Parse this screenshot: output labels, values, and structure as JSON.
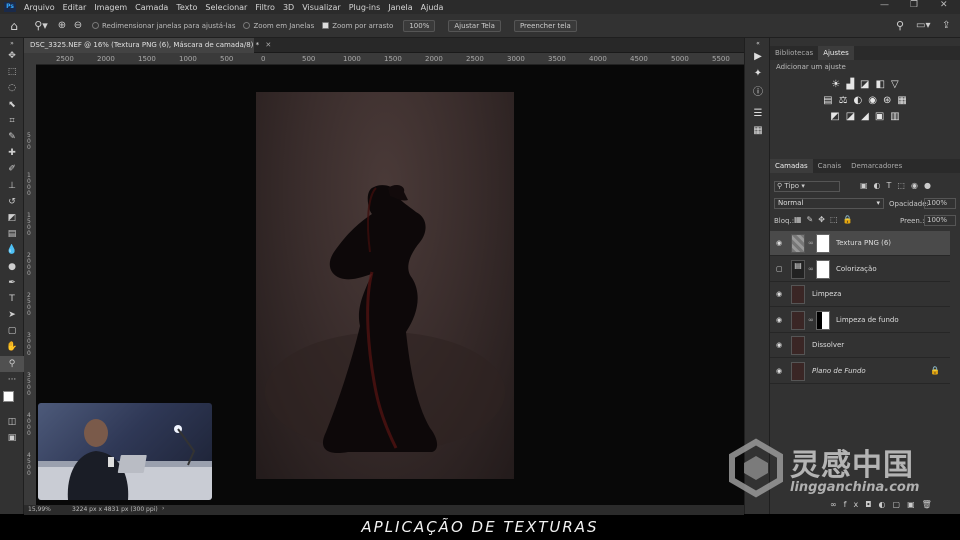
{
  "app": {
    "logo": "Ps"
  },
  "menu": [
    "Arquivo",
    "Editar",
    "Imagem",
    "Camada",
    "Texto",
    "Selecionar",
    "Filtro",
    "3D",
    "Visualizar",
    "Plug-ins",
    "Janela",
    "Ajuda"
  ],
  "options": {
    "resize_windows": "Redimensionar janelas para ajustá-las",
    "zoom_all": "Zoom em Janelas",
    "scrubby_zoom": "Zoom por arrasto",
    "zoom_value": "100%",
    "fit_screen": "Ajustar Tela",
    "fill_screen": "Preencher tela"
  },
  "document": {
    "tab_title": "DSC_3325.NEF @ 16% (Textura PNG (6), Máscara de camada/8) *",
    "zoom": "15,99%",
    "info": "3224 px x 4831 px (300 ppi)"
  },
  "ruler": {
    "h_ticks": [
      "2500",
      "2000",
      "1500",
      "1000",
      "500",
      "0",
      "500",
      "1000",
      "1500",
      "2000",
      "2500",
      "3000",
      "3500",
      "4000",
      "4500",
      "5000",
      "5500"
    ],
    "v_ticks": [
      "5\n0\n0",
      "1\n0\n0\n0",
      "1\n5\n0\n0",
      "2\n0\n0\n0",
      "2\n5\n0\n0",
      "3\n0\n0\n0",
      "3\n5\n0\n0",
      "4\n0\n0\n0",
      "4\n5\n0\n0"
    ]
  },
  "panels": {
    "top_tabs": [
      "Bibliotecas",
      "Ajustes"
    ],
    "adjust_hint": "Adicionar um ajuste",
    "layer_tabs": [
      "Camadas",
      "Canais",
      "Demarcadores"
    ],
    "filter_kind": "Tipo",
    "blend_mode": "Normal",
    "opacity_label": "Opacidade:",
    "opacity_value": "100%",
    "lock_label": "Bloq.:",
    "fill_label": "Preen.:",
    "fill_value": "100%"
  },
  "layers": [
    {
      "name": "Textura PNG (6)",
      "visible": true,
      "selected": true,
      "has_mask": true
    },
    {
      "name": "Colorização",
      "visible": false,
      "selected": false,
      "has_mask": true
    },
    {
      "name": "Limpeza",
      "visible": true,
      "selected": false,
      "has_mask": false
    },
    {
      "name": "Limpeza de fundo",
      "visible": true,
      "selected": false,
      "has_mask": true
    },
    {
      "name": "Dissolver",
      "visible": true,
      "selected": false,
      "has_mask": false
    },
    {
      "name": "Plano de Fundo",
      "visible": true,
      "selected": false,
      "has_mask": false,
      "locked": true
    }
  ],
  "caption": "APLICAÇÃO DE TEXTURAS",
  "watermark": {
    "brand": "灵感中国",
    "url": "lingganchina.com"
  },
  "colors": {
    "accent": "#31a8ff",
    "panel": "#323232",
    "canvas": "#080808"
  }
}
